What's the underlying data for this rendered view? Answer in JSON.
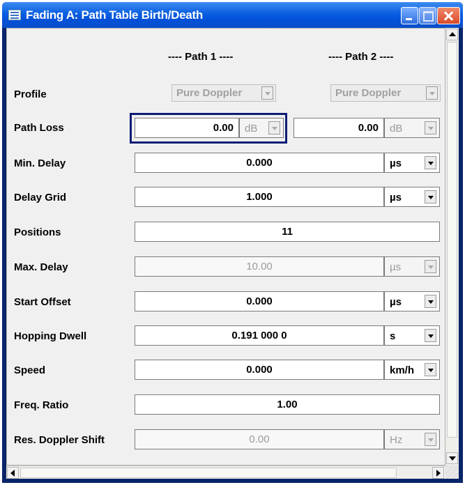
{
  "window": {
    "title": "Fading  A: Path Table Birth/Death"
  },
  "columns": {
    "path1": "---- Path 1 ----",
    "path2": "---- Path 2 ----"
  },
  "rows": {
    "profile": {
      "label": "Profile",
      "path1": "Pure Doppler",
      "path2": "Pure Doppler"
    },
    "path_loss": {
      "label": "Path Loss",
      "path1_value": "0.00",
      "path1_unit": "dB",
      "path2_value": "0.00",
      "path2_unit": "dB"
    },
    "min_delay": {
      "label": "Min. Delay",
      "value": "0.000",
      "unit": "µs"
    },
    "delay_grid": {
      "label": "Delay Grid",
      "value": "1.000",
      "unit": "µs"
    },
    "positions": {
      "label": "Positions",
      "value": "11"
    },
    "max_delay": {
      "label": "Max. Delay",
      "value": "10.00",
      "unit": "µs"
    },
    "start_offset": {
      "label": "Start Offset",
      "value": "0.000",
      "unit": "µs"
    },
    "hopping_dwell": {
      "label": "Hopping Dwell",
      "value": "0.191 000 0",
      "unit": "s"
    },
    "speed": {
      "label": "Speed",
      "value": "0.000",
      "unit": "km/h"
    },
    "freq_ratio": {
      "label": "Freq. Ratio",
      "value": "1.00"
    },
    "res_doppler_shift": {
      "label": "Res. Doppler Shift",
      "value": "0.00",
      "unit": "Hz"
    }
  },
  "icons": {
    "window": "window-menu-icon",
    "minimize": "minimize-icon",
    "maximize": "maximize-icon",
    "close": "close-icon"
  },
  "colors": {
    "titlebar": "#0a5ee0",
    "focus_border": "#0d1d74",
    "panel": "#f0f0f0"
  }
}
